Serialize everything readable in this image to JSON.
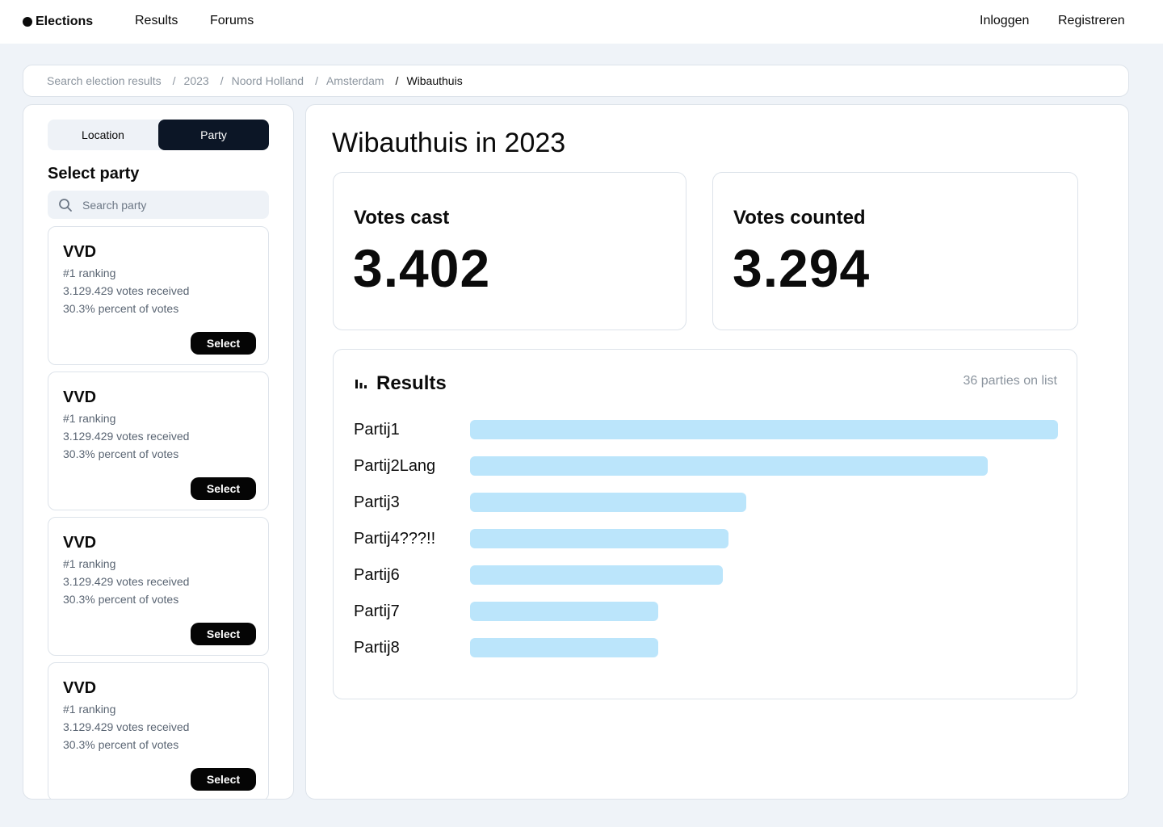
{
  "nav": {
    "brand": "Elections",
    "links": [
      "Results",
      "Forums"
    ],
    "login": "Inloggen",
    "register": "Registreren"
  },
  "breadcrumb": {
    "items": [
      "Search election results",
      "2023",
      "Noord Holland",
      "Amsterdam"
    ],
    "current": "Wibauthuis"
  },
  "sidebar": {
    "tabs": [
      {
        "label": "Location",
        "active": false
      },
      {
        "label": "Party",
        "active": true
      }
    ],
    "title": "Select party",
    "search_placeholder": "Search party",
    "parties": [
      {
        "name": "VVD",
        "ranking": "#1 ranking",
        "votes": "3.129.429 votes received",
        "percent": "30.3% percent of votes",
        "button": "Select"
      },
      {
        "name": "VVD",
        "ranking": "#1 ranking",
        "votes": "3.129.429 votes received",
        "percent": "30.3% percent of votes",
        "button": "Select"
      },
      {
        "name": "VVD",
        "ranking": "#1 ranking",
        "votes": "3.129.429 votes received",
        "percent": "30.3% percent of votes",
        "button": "Select"
      },
      {
        "name": "VVD",
        "ranking": "#1 ranking",
        "votes": "3.129.429 votes received",
        "percent": "30.3% percent of votes",
        "button": "Select"
      }
    ]
  },
  "main": {
    "title": "Wibauthuis in 2023",
    "stats": [
      {
        "label": "Votes cast",
        "value": "3.402"
      },
      {
        "label": "Votes counted",
        "value": "3.294"
      }
    ],
    "results": {
      "title": "Results",
      "count": "36 parties on list"
    }
  },
  "colors": {
    "accent_dark": "#0c1626",
    "bar": "#bbe5fb",
    "background": "#eff3f8"
  },
  "chart_data": {
    "type": "bar",
    "orientation": "horizontal",
    "categories": [
      "Partij1",
      "Partij2Lang",
      "Partij3",
      "Partij4???!!",
      "Partij6",
      "Partij7",
      "Partij8"
    ],
    "values": [
      100,
      88,
      47,
      44,
      43,
      32,
      32
    ],
    "value_scale": "percent of largest bar",
    "title": "Results",
    "grid": false
  }
}
